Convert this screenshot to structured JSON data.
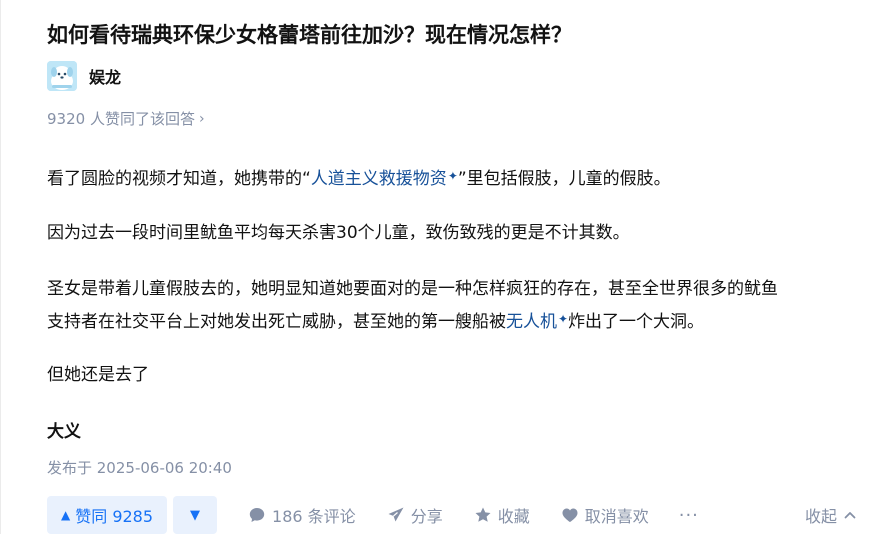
{
  "question": {
    "title": "如何看待瑞典环保少女格蕾塔前往加沙？现在情况怎样？"
  },
  "author": {
    "name": "娱龙",
    "avatar_icon": "cartoon-dog-avatar-icon",
    "avatar_color": "#bfe6f7"
  },
  "votes_summary": {
    "text": "9320 人赞同了该回答",
    "chevron": "›"
  },
  "body": {
    "p1_before": "看了圆脸的视频才知道，她携带的“",
    "p1_link": "人道主义救援物资",
    "p1_after": "”里包括假肢，儿童的假肢。",
    "p2": "因为过去一段时间里鱿鱼平均每天杀害30个儿童，致伤致残的更是不计其数。",
    "p3_line1": "圣女是带着儿童假肢去的，她明显知道她要面对的是一种怎样疯狂的存在，甚至全世界很多的鱿鱼",
    "p3_line2_before": "支持者在社交平台上对她发出死亡威胁，甚至她的第一艘船被",
    "p3_line2_link": "无人机",
    "p3_line2_after": "炸出了一个大洞。",
    "p4": "但她还是去了",
    "sparkle": "✦"
  },
  "signature": "大义",
  "publish_time": "发布于 2025-06-06 20:40",
  "actions": {
    "upvote_label": "赞同 9285",
    "upvote_glyph": "▲",
    "downvote_glyph": "▼",
    "comments_label": "186 条评论",
    "share_label": "分享",
    "collect_label": "收藏",
    "unlike_label": "取消喜欢",
    "more_label": "···",
    "collapse_label": "收起"
  },
  "colors": {
    "link": "#175199",
    "accent": "#1772f6",
    "accent_bg": "#e9f1fd",
    "muted": "#8590a6"
  }
}
